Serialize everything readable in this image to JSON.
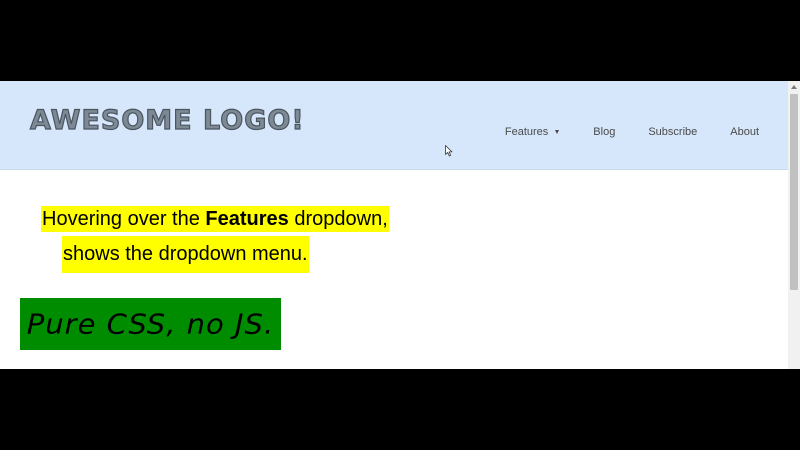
{
  "header": {
    "logo": "AWESOME LOGO!",
    "nav": [
      {
        "label": "Features",
        "has_dropdown": true
      },
      {
        "label": "Blog"
      },
      {
        "label": "Subscribe"
      },
      {
        "label": "About"
      }
    ]
  },
  "main": {
    "note_part1": "Hovering over the ",
    "note_bold": "Features",
    "note_part2": " dropdown,",
    "note_line2": "shows the dropdown menu.",
    "badge": "Pure CSS, no JS."
  },
  "colors": {
    "header_bg": "#d6e7fb",
    "highlight": "#ffff00",
    "badge_bg": "#008c00",
    "frame": "#000000"
  },
  "icons": [
    "caret-down-icon",
    "mouse-cursor-icon"
  ]
}
